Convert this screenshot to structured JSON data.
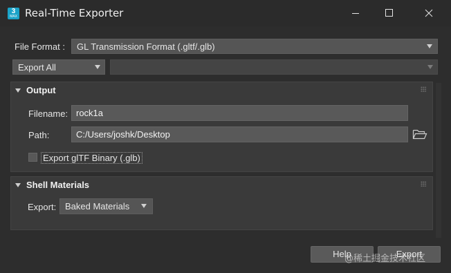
{
  "window": {
    "title": "Real-Time Exporter",
    "app_icon": {
      "digit": "3",
      "caption": "MAX"
    }
  },
  "file_format": {
    "label": "File Format :",
    "value": "GL Transmission Format (.gltf/.glb)"
  },
  "export_scope": {
    "value": "Export All"
  },
  "secondary_select": {
    "value": ""
  },
  "output": {
    "title": "Output",
    "filename_label": "Filename:",
    "filename_value": "rock1a",
    "path_label": "Path:",
    "path_value": "C:/Users/joshk/Desktop",
    "binary_label": "Export glTF Binary (.glb)",
    "binary_checked": false
  },
  "shell_materials": {
    "title": "Shell Materials",
    "export_label": "Export:",
    "export_value": "Baked Materials"
  },
  "buttons": {
    "help": "Help",
    "export": "Export"
  },
  "watermark": "@稀土掘金技术社区",
  "icons": [
    "minimize-icon",
    "maximize-icon",
    "close-icon",
    "folder-icon",
    "dropdown-arrow-icon",
    "collapse-triangle-icon",
    "panel-grip-icon"
  ]
}
